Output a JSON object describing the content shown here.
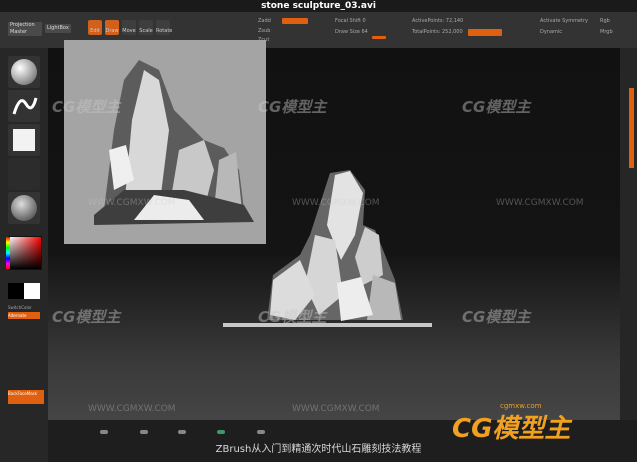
{
  "title": "stone sculpture_03.avi",
  "topbar": {
    "projection_master": "Projection\nMaster",
    "lightbox": "LightBox",
    "modes": [
      "Edit",
      "Draw",
      "Move",
      "Scale",
      "Rotate"
    ],
    "zadd": "Zadd",
    "zsub": "Zsub",
    "zcut": "Zcut",
    "focal_shift": "Focal Shift 0",
    "draw_size": "Draw Size 64",
    "active_points": "ActivePoints: 72,140",
    "total_points": "TotalPoints: 252,000",
    "activate_symmetry": "Activate Symmetry",
    "dynamic": "Dynamic",
    "rgb": "Rgb",
    "mrgb": "Mrgb"
  },
  "leftbar": {
    "switch_color": "SwitchColor",
    "alternate": "Alternate",
    "gradient_label": "BackFaceMask"
  },
  "watermarks": {
    "logo_text": "CG模型主",
    "url": "WWW.CGMXW.COM",
    "corner_url": "cgmxw.com"
  },
  "caption": "ZBrush从入门到精通次时代山石雕刻技法教程",
  "colors": {
    "accent": "#e06010",
    "logo": "#f2a020",
    "background": "#1a1a1a"
  }
}
